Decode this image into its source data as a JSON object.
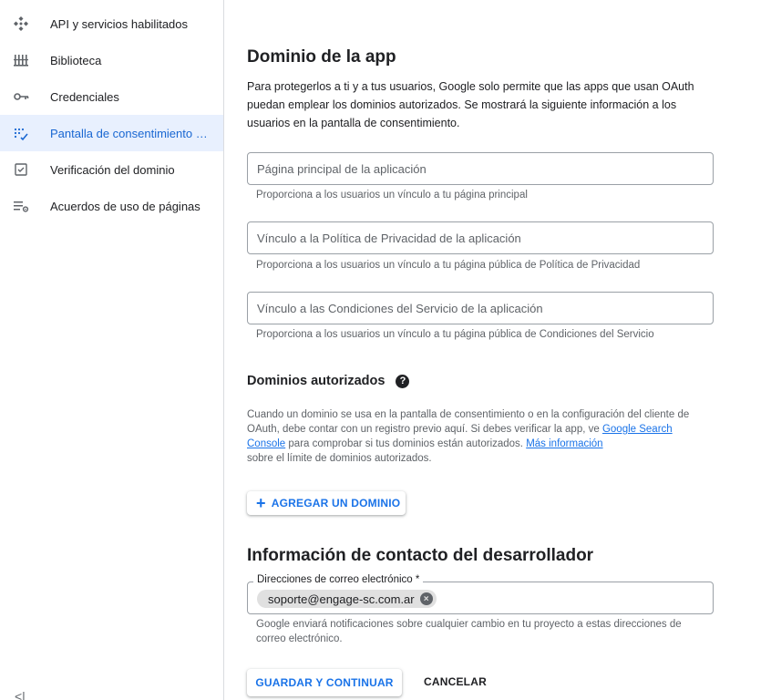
{
  "sidebar": {
    "items": [
      {
        "label": "API y servicios habilitados",
        "icon": "api-icon"
      },
      {
        "label": "Biblioteca",
        "icon": "library-icon"
      },
      {
        "label": "Credenciales",
        "icon": "key-icon"
      },
      {
        "label": "Pantalla de consentimiento …",
        "icon": "consent-icon",
        "active": true
      },
      {
        "label": "Verificación del dominio",
        "icon": "checkbox-icon"
      },
      {
        "label": "Acuerdos de uso de páginas",
        "icon": "settings-list-icon"
      }
    ],
    "collapse_glyph": "<|"
  },
  "domain": {
    "title": "Dominio de la app",
    "description": "Para protegerlos a ti y a tus usuarios, Google solo permite que las apps que usan OAuth puedan emplear los dominios autorizados. Se mostrará la siguiente información a los usuarios en la pantalla de consentimiento.",
    "fields": [
      {
        "placeholder": "Página principal de la aplicación",
        "value": "",
        "hint": "Proporciona a los usuarios un vínculo a tu página principal"
      },
      {
        "placeholder": "Vínculo a la Política de Privacidad de la aplicación",
        "value": "",
        "hint": "Proporciona a los usuarios un vínculo a tu página pública de Política de Privacidad"
      },
      {
        "placeholder": "Vínculo a las Condiciones del Servicio de la aplicación",
        "value": "",
        "hint": "Proporciona a los usuarios un vínculo a tu página pública de Condiciones del Servicio"
      }
    ]
  },
  "authorized": {
    "title": "Dominios autorizados",
    "help_glyph": "?",
    "text_1": "Cuando un dominio se usa en la pantalla de consentimiento o en la configuración del cliente de OAuth, debe contar con un registro previo aquí. Si debes verificar la app, ve",
    "link_1": "Google Search Console",
    "text_2": " para comprobar si tus dominios están autorizados. ",
    "link_2": "Más información",
    "text_3": "sobre el límite de dominios autorizados.",
    "add_button": "AGREGAR UN DOMINIO",
    "add_glyph": "+"
  },
  "contact": {
    "title": "Información de contacto del desarrollador",
    "email_label": "Direcciones de correo electrónico *",
    "email_chip": "soporte@engage-sc.com.ar",
    "remove_glyph": "×",
    "hint": "Google enviará notificaciones sobre cualquier cambio en tu proyecto a estas direcciones de correo electrónico."
  },
  "actions": {
    "save": "GUARDAR Y CONTINUAR",
    "cancel": "CANCELAR"
  },
  "colors": {
    "accent": "#1a73e8",
    "active_bg": "#e8f0fe",
    "text": "#202124",
    "muted": "#5f6368"
  }
}
